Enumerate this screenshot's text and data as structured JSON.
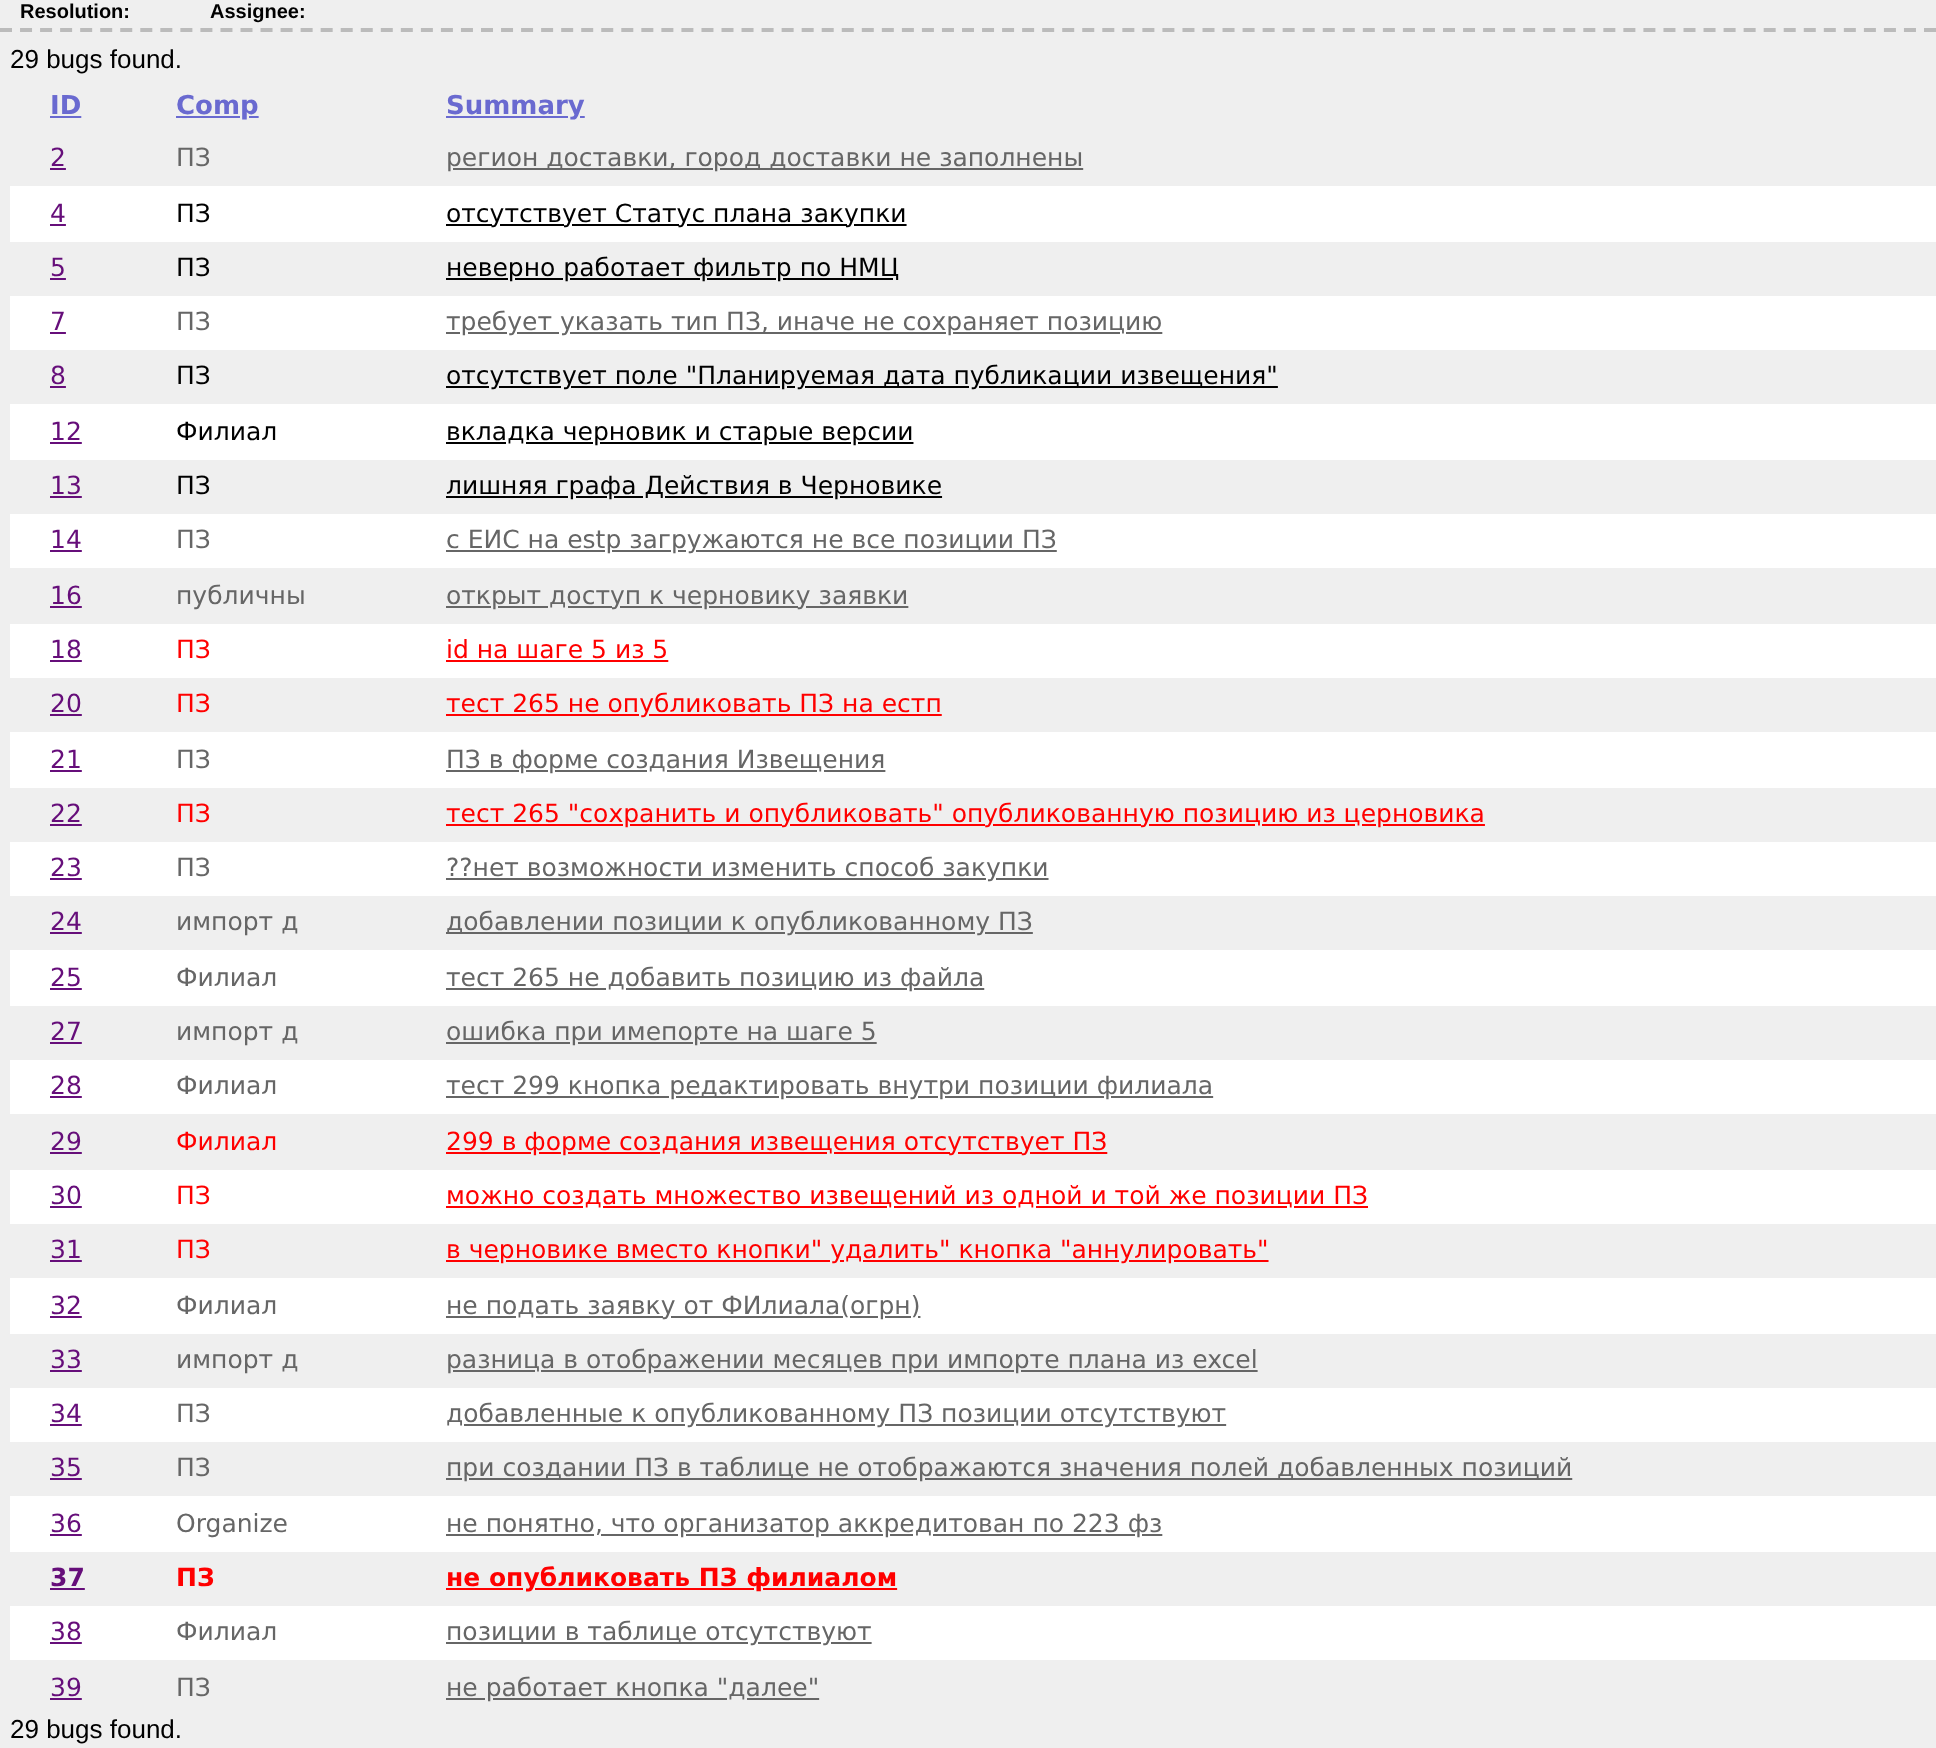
{
  "header": {
    "labels": [
      "Resolution:",
      "Assignee:"
    ]
  },
  "count_top": "29 bugs found.",
  "columns": [
    "ID",
    "Comp",
    "Summary"
  ],
  "rows": [
    {
      "id": "2",
      "comp": "ПЗ",
      "summary": "регион доставки, город доставки не заполнены",
      "color": "#666666",
      "bold": false
    },
    {
      "id": "4",
      "comp": "ПЗ",
      "summary": "отсутствует Статус плана закупки",
      "color": "#000000",
      "bold": false
    },
    {
      "id": "5",
      "comp": "ПЗ",
      "summary": "неверно работает фильтр по НМЦ",
      "color": "#000000",
      "bold": false
    },
    {
      "id": "7",
      "comp": "ПЗ",
      "summary": "требует указать тип ПЗ, иначе не сохраняет позицию",
      "color": "#666666",
      "bold": false
    },
    {
      "id": "8",
      "comp": "ПЗ",
      "summary": "отсутствует поле \"Планируемая дата публикации извещения\"",
      "color": "#000000",
      "bold": false
    },
    {
      "id": "12",
      "comp": "Филиал",
      "summary": "вкладка черновик и старые версии",
      "color": "#000000",
      "bold": false
    },
    {
      "id": "13",
      "comp": "ПЗ",
      "summary": "лишняя графа Действия в Черновике",
      "color": "#000000",
      "bold": false
    },
    {
      "id": "14",
      "comp": "ПЗ",
      "summary": "с ЕИС на estp загружаются не все позиции ПЗ",
      "color": "#666666",
      "bold": false
    },
    {
      "id": "16",
      "comp": "публичны",
      "summary": "открыт доступ к черновику заявки",
      "color": "#666666",
      "bold": false
    },
    {
      "id": "18",
      "comp": "ПЗ",
      "summary": "id на шаге 5 из 5",
      "color": "#ff0000",
      "bold": false
    },
    {
      "id": "20",
      "comp": "ПЗ",
      "summary": "тест 265 не опубликовать ПЗ на естп",
      "color": "#ff0000",
      "bold": false
    },
    {
      "id": "21",
      "comp": "ПЗ",
      "summary": "ПЗ в форме создания Извещения",
      "color": "#666666",
      "bold": false
    },
    {
      "id": "22",
      "comp": "ПЗ",
      "summary": "тест 265 \"сохранить и опубликовать\" опубликованную позицию из церновика",
      "color": "#ff0000",
      "bold": false
    },
    {
      "id": "23",
      "comp": "ПЗ",
      "summary": "??нет возможности изменить способ закупки",
      "color": "#666666",
      "bold": false
    },
    {
      "id": "24",
      "comp": "импорт д",
      "summary": "добавлении позиции к опубликованному ПЗ",
      "color": "#666666",
      "bold": false
    },
    {
      "id": "25",
      "comp": "Филиал",
      "summary": "тест 265 не добавить позицию из файла",
      "color": "#666666",
      "bold": false
    },
    {
      "id": "27",
      "comp": "импорт д",
      "summary": "ошибка при имепорте на шаге 5",
      "color": "#666666",
      "bold": false
    },
    {
      "id": "28",
      "comp": "Филиал",
      "summary": "тест 299 кнопка редактировать внутри позиции филиала",
      "color": "#666666",
      "bold": false
    },
    {
      "id": "29",
      "comp": "Филиал",
      "summary": "299 в форме создания извещения отсутствует ПЗ",
      "color": "#ff0000",
      "bold": false
    },
    {
      "id": "30",
      "comp": "ПЗ",
      "summary": "можно создать множество извещений из одной и той же позиции ПЗ",
      "color": "#ff0000",
      "bold": false
    },
    {
      "id": "31",
      "comp": "ПЗ",
      "summary": "в черновике вместо кнопки\" удалить\" кнопка \"аннулировать\"",
      "color": "#ff0000",
      "bold": false
    },
    {
      "id": "32",
      "comp": "Филиал",
      "summary": "не подать заявку от ФИлиала(огрн)",
      "color": "#666666",
      "bold": false
    },
    {
      "id": "33",
      "comp": "импорт д",
      "summary": "разница в отображении месяцев при импорте плана из excel",
      "color": "#666666",
      "bold": false
    },
    {
      "id": "34",
      "comp": "ПЗ",
      "summary": "добавленные к опубликованному ПЗ позиции отсутствуют",
      "color": "#666666",
      "bold": false
    },
    {
      "id": "35",
      "comp": "ПЗ",
      "summary": "при создании ПЗ в таблице не отображаются значения полей добавленных позиций",
      "color": "#666666",
      "bold": false
    },
    {
      "id": "36",
      "comp": "Organize",
      "summary": "не понятно, что организатор аккредитован по 223 фз",
      "color": "#666666",
      "bold": false
    },
    {
      "id": "37",
      "comp": "ПЗ",
      "summary": "не опубликовать ПЗ филиалом",
      "color": "#ff0000",
      "bold": true
    },
    {
      "id": "38",
      "comp": "Филиал",
      "summary": "позиции в таблице отсутствуют",
      "color": "#666666",
      "bold": false
    },
    {
      "id": "39",
      "comp": "ПЗ",
      "summary": "не работает кнопка \"далее\"",
      "color": "#666666",
      "bold": false
    }
  ],
  "count_bottom": "29 bugs found."
}
